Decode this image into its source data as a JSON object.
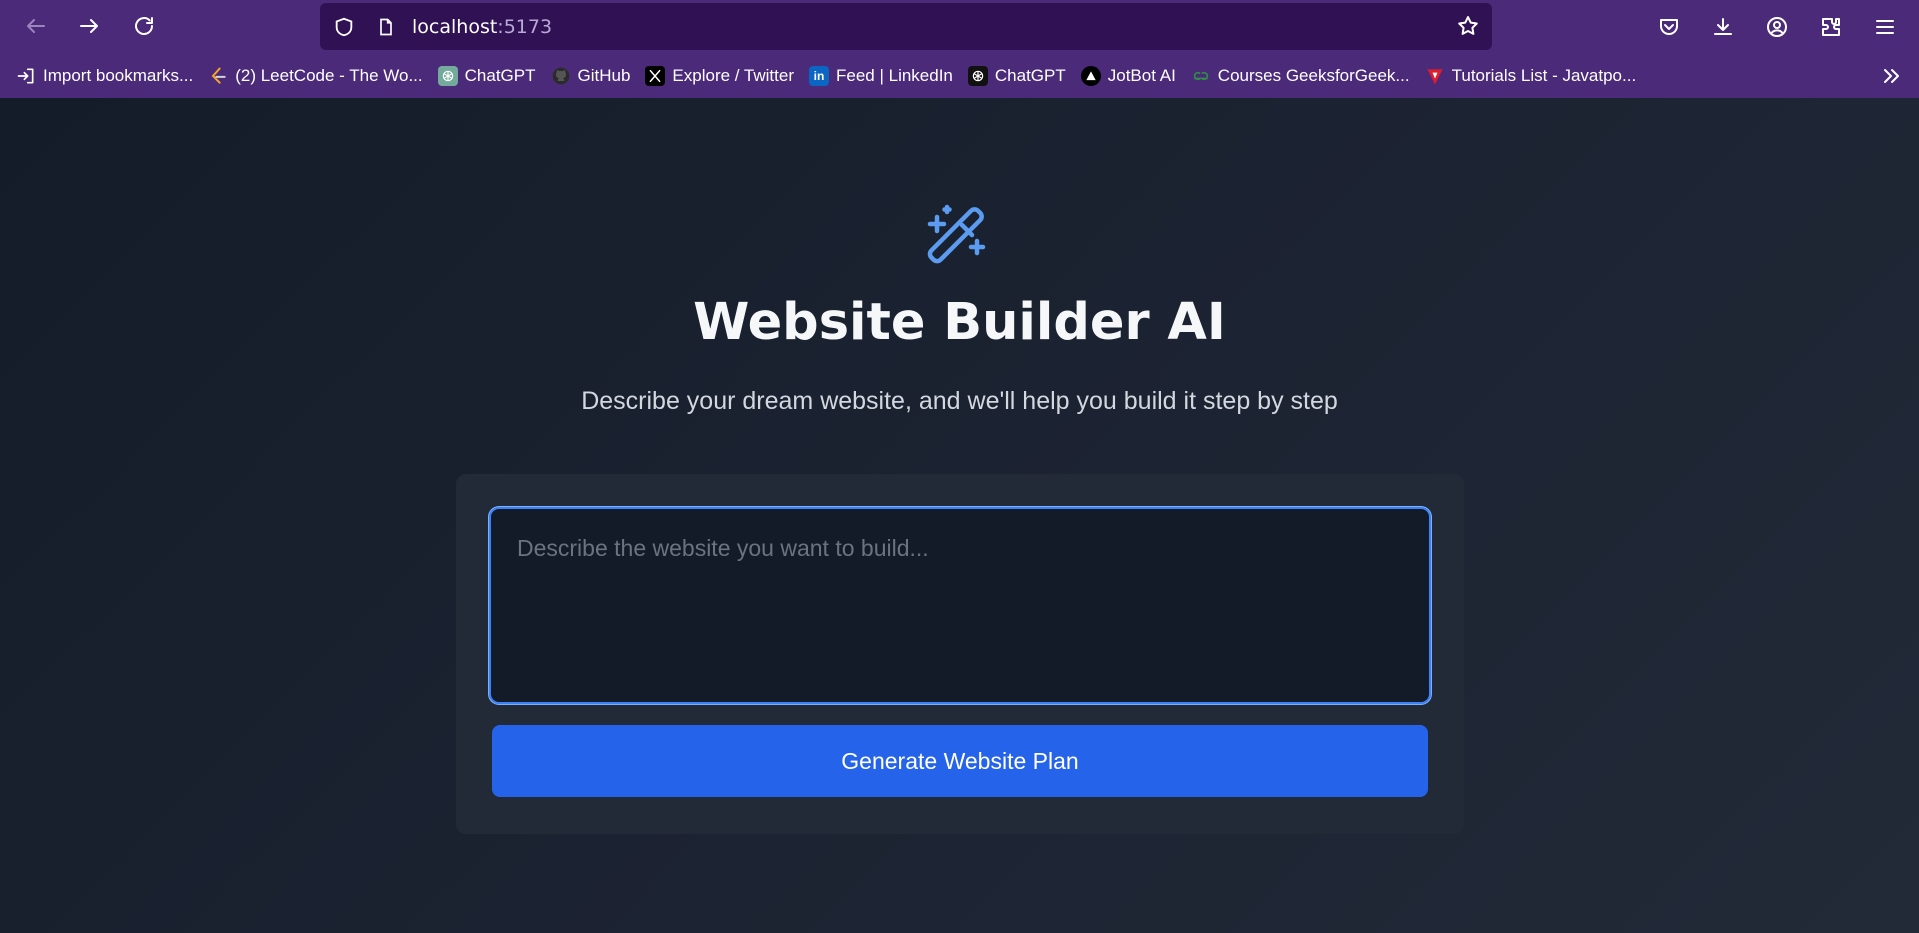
{
  "browser": {
    "url_host": "localhost",
    "url_port": ":5173",
    "bookmarks": [
      {
        "label": "Import bookmarks...",
        "icon": "import-icon"
      },
      {
        "label": "(2) LeetCode - The Wo...",
        "icon": "leetcode-icon"
      },
      {
        "label": "ChatGPT",
        "icon": "chatgpt-icon"
      },
      {
        "label": "GitHub",
        "icon": "github-icon"
      },
      {
        "label": "Explore / Twitter",
        "icon": "x-icon"
      },
      {
        "label": "Feed | LinkedIn",
        "icon": "linkedin-icon"
      },
      {
        "label": "ChatGPT",
        "icon": "chatgpt-icon"
      },
      {
        "label": "JotBot AI",
        "icon": "jotbot-icon"
      },
      {
        "label": "Courses GeeksforGeek...",
        "icon": "geeksforgeeks-icon"
      },
      {
        "label": "Tutorials List - Javatpo...",
        "icon": "javatpoint-icon"
      }
    ]
  },
  "hero": {
    "icon": "magic-wand-icon",
    "title": "Website Builder AI",
    "subtitle": "Describe your dream website, and we'll help you build it step by step"
  },
  "form": {
    "prompt_placeholder": "Describe the website you want to build...",
    "prompt_value": "",
    "submit_label": "Generate Website Plan"
  },
  "colors": {
    "browser_bar": "#4b2a7a",
    "url_field": "#2f1154",
    "accent": "#2563eb",
    "icon_blue": "#5b9bf0",
    "page_bg": "#1b2230",
    "card_bg": "#222a38"
  }
}
